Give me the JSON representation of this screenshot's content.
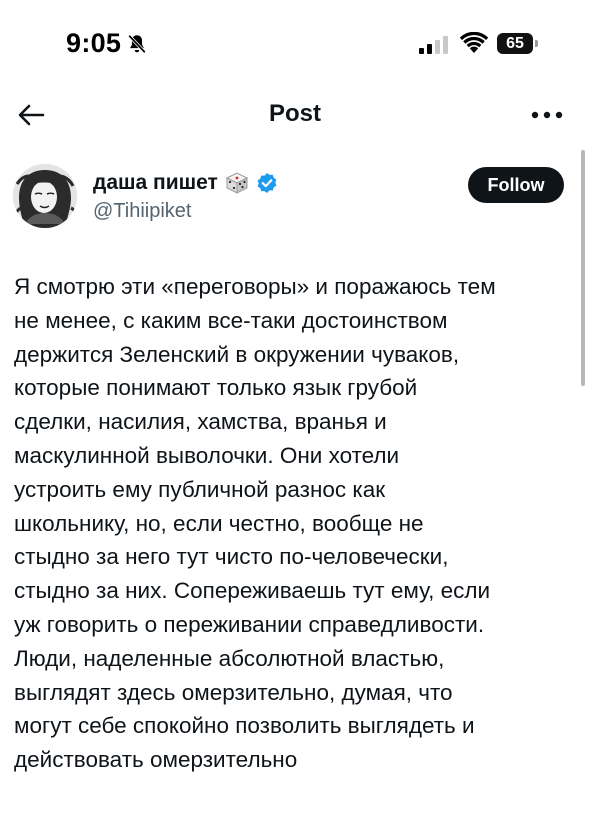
{
  "status_bar": {
    "time": "9:05",
    "battery_level": "65"
  },
  "header": {
    "title": "Post"
  },
  "author": {
    "name": "даша пишет",
    "handle": "@Tihiipiket",
    "verified": true
  },
  "follow_button": {
    "label": "Follow"
  },
  "post": {
    "lines": [
      "Я смотрю эти «переговоры» и поражаюсь тем",
      "не менее, с каким все-таки достоинством",
      "держится Зеленский в окружении чуваков,",
      "которые понимают только язык грубой",
      "сделки, насилия, хамства, вранья и",
      "маскулинной выволочки. Они хотели",
      "устроить ему публичной разнос как",
      "школьнику, но, если честно, вообще не",
      "стыдно за него тут чисто по-человечески,",
      "стыдно за них. Сопереживаешь тут ему, если",
      "уж говорить о переживании справедливости.",
      "Люди, наделенные абсолютной властью,",
      "выглядят здесь омерзительно, думая, что",
      "могут себе спокойно позволить выглядеть и",
      "действовать омерзительно"
    ]
  },
  "colors": {
    "text": "#0f1419",
    "secondary_text": "#536471",
    "verified": "#1d9bf0",
    "follow_bg": "#0f1419"
  }
}
